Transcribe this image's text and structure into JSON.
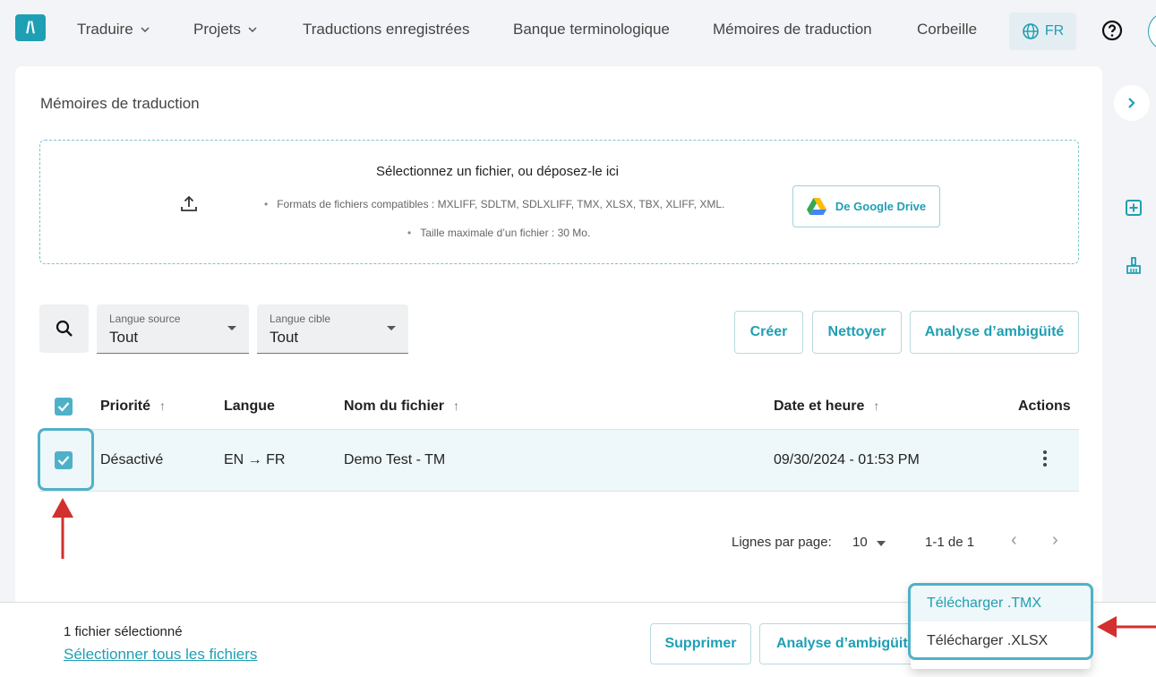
{
  "nav": {
    "logo": "/\\",
    "items": [
      {
        "label": "Traduire",
        "dropdown": true
      },
      {
        "label": "Projets",
        "dropdown": true
      },
      {
        "label": "Traductions enregistrées",
        "dropdown": false
      },
      {
        "label": "Banque terminologique",
        "dropdown": false
      },
      {
        "label": "Mémoires de traduction",
        "dropdown": false
      },
      {
        "label": "Corbeille",
        "dropdown": false
      }
    ],
    "language": "FR"
  },
  "page": {
    "title": "Mémoires de traduction"
  },
  "dropzone": {
    "title": "Sélectionnez un fichier, ou déposez-le ici",
    "formats": "Formats de fichiers compatibles : MXLIFF, SDLTM, SDLXLIFF, TMX, XLSX, TBX, XLIFF, XML.",
    "max_size": "Taille maximale d’un fichier : 30 Mo.",
    "gdrive_label": "De Google Drive"
  },
  "filters": {
    "source": {
      "label": "Langue source",
      "value": "Tout"
    },
    "target": {
      "label": "Langue cible",
      "value": "Tout"
    }
  },
  "actions": {
    "create": "Créer",
    "clean": "Nettoyer",
    "ambiguity": "Analyse d’ambigüité"
  },
  "table": {
    "headers": {
      "priority": "Priorité",
      "language": "Langue",
      "filename": "Nom du fichier",
      "datetime": "Date et heure",
      "actions": "Actions"
    },
    "sort_glyph": "↑",
    "rows": [
      {
        "priority": "Désactivé",
        "language": "EN → FR",
        "filename": "Demo Test - TM",
        "datetime": "09/30/2024 - 01:53 PM"
      }
    ]
  },
  "pagination": {
    "rows_label": "Lignes par page:",
    "rows_value": "10",
    "range": "1-1 de 1",
    "prev": "‹",
    "next": "›"
  },
  "bottombar": {
    "selected_text": "1 fichier sélectionné",
    "select_all": "Sélectionner tous les fichiers",
    "delete": "Supprimer",
    "ambiguity": "Analyse d’ambigüité"
  },
  "menu": {
    "items": [
      "Télécharger .TMX",
      "Télécharger .XLSX"
    ]
  },
  "colors": {
    "accent": "#1f9fb4",
    "highlight": "#4fb1c8",
    "annotation": "#d32f2f"
  }
}
